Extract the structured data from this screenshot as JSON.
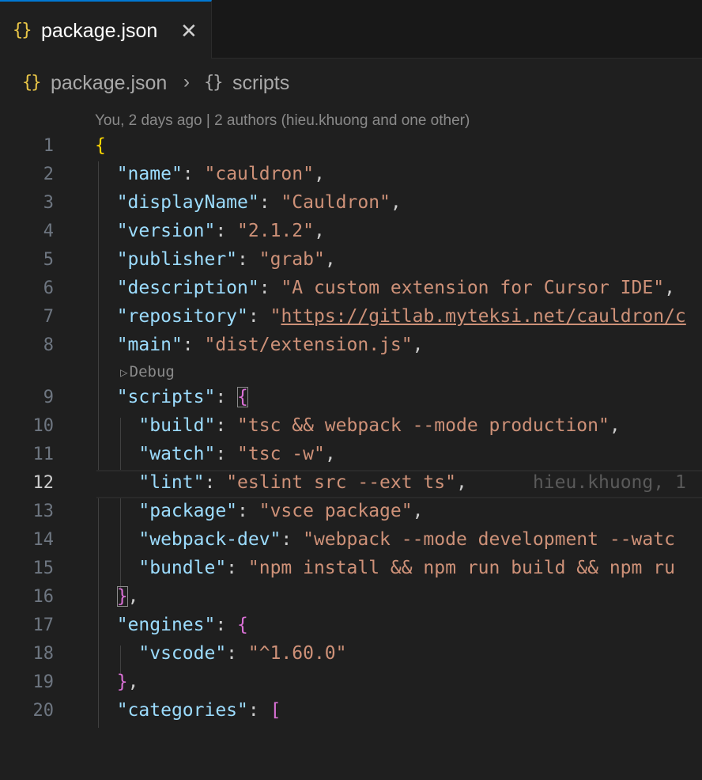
{
  "tab": {
    "icon": "json-braces-icon",
    "label": "package.json",
    "close_icon": "close-icon"
  },
  "breadcrumb": {
    "file": "package.json",
    "separator_icon": "chevron-right-icon",
    "symbol_icon": "braces-icon",
    "symbol": "scripts"
  },
  "blame_header": "You, 2 days ago | 2 authors (hieu.khuong and one other)",
  "codelens": {
    "icon": "play-icon",
    "label": "Debug"
  },
  "inline_blame": "hieu.khuong, 1",
  "current_line": 12,
  "lines": [
    {
      "n": "1"
    },
    {
      "n": "2"
    },
    {
      "n": "3"
    },
    {
      "n": "4"
    },
    {
      "n": "5"
    },
    {
      "n": "6"
    },
    {
      "n": "7"
    },
    {
      "n": "8"
    },
    {
      "n": "9"
    },
    {
      "n": "10"
    },
    {
      "n": "11"
    },
    {
      "n": "12"
    },
    {
      "n": "13"
    },
    {
      "n": "14"
    },
    {
      "n": "15"
    },
    {
      "n": "16"
    },
    {
      "n": "17"
    },
    {
      "n": "18"
    },
    {
      "n": "19"
    },
    {
      "n": "20"
    }
  ],
  "tokens": {
    "name_key": "\"name\"",
    "name_val": "\"cauldron\"",
    "displayName_key": "\"displayName\"",
    "displayName_val": "\"Cauldron\"",
    "version_key": "\"version\"",
    "version_val": "\"2.1.2\"",
    "publisher_key": "\"publisher\"",
    "publisher_val": "\"grab\"",
    "description_key": "\"description\"",
    "description_val": "\"A custom extension for Cursor IDE\"",
    "repository_key": "\"repository\"",
    "repository_val_q": "\"",
    "repository_val": "https://gitlab.myteksi.net/cauldron/c",
    "main_key": "\"main\"",
    "main_val": "\"dist/extension.js\"",
    "scripts_key": "\"scripts\"",
    "build_key": "\"build\"",
    "build_val": "\"tsc && webpack --mode production\"",
    "watch_key": "\"watch\"",
    "watch_val": "\"tsc -w\"",
    "lint_key": "\"lint\"",
    "lint_val": "\"eslint src --ext ts\"",
    "package_key": "\"package\"",
    "package_val": "\"vsce package\"",
    "webpackdev_key": "\"webpack-dev\"",
    "webpackdev_val": "\"webpack --mode development --watc",
    "bundle_key": "\"bundle\"",
    "bundle_val": "\"npm install && npm run build && npm ru",
    "engines_key": "\"engines\"",
    "vscode_key": "\"vscode\"",
    "vscode_val": "\"^1.60.0\"",
    "categories_key": "\"categories\""
  },
  "colors": {
    "key": "#9cdcfe",
    "string": "#ce9178",
    "bracket_l1": "#ffd700",
    "bracket_l2": "#da70d6",
    "tab_accent": "#0078d4"
  }
}
